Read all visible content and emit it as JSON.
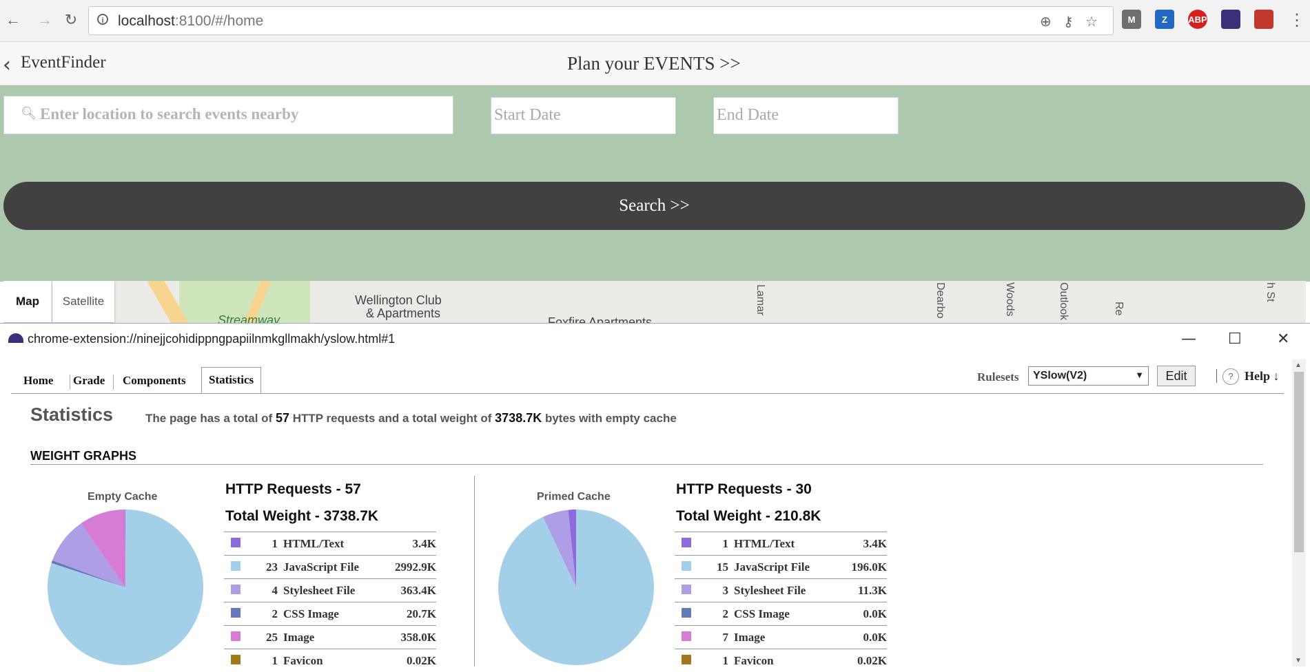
{
  "browser": {
    "url_host": "localhost",
    "url_rest": ":8100/#/home",
    "back_glyph": "←",
    "forward_glyph": "→",
    "reload_glyph": "↻",
    "extensions": [
      {
        "name": "m-extension",
        "label": "M",
        "color": "#6f6f6f"
      },
      {
        "name": "zotero-extension",
        "label": "Z",
        "color": "#2368c2"
      },
      {
        "name": "adblock-extension",
        "label": "ABP",
        "color": "#d61f1f"
      },
      {
        "name": "yslow-extension",
        "label": "",
        "color": "#3b2f79"
      },
      {
        "name": "red-extension",
        "label": "",
        "color": "#c0392b"
      }
    ]
  },
  "app": {
    "title": "EventFinder",
    "plan_link": "Plan your EVENTS >>",
    "search": {
      "location_placeholder": "Enter location to search events nearby",
      "start_placeholder": "Start Date",
      "end_placeholder": "End Date",
      "button_label": "Search >>"
    },
    "map": {
      "map_button": "Map",
      "satellite_button": "Satellite",
      "labels": [
        "Wellington Club",
        "& Apartments",
        "Foxfire Apartments",
        "Streamway"
      ],
      "vertical_labels": [
        "Lamar",
        "Dearbo",
        "Woods",
        "Outlook",
        "Re",
        "h St"
      ]
    }
  },
  "yslow": {
    "window_title": "chrome-extension://ninejjcohidippngpapiilnmkgllmakh/yslow.html#1",
    "tabs": [
      "Home",
      "Grade",
      "Components",
      "Statistics"
    ],
    "active_tab": "Statistics",
    "rulesets_label": "Rulesets",
    "ruleset_value": "YSlow(V2)",
    "edit_label": "Edit",
    "help_label": "Help ↓",
    "heading": "Statistics",
    "summary": {
      "prefix": "The page has a total of",
      "requests": "57",
      "middle": "HTTP requests and a total weight of",
      "weight": "3738.7K",
      "suffix": "bytes with empty cache"
    },
    "weight_graphs_heading": "WEIGHT GRAPHS",
    "colors": {
      "html": "#8e6ae0",
      "js": "#a3d0e8",
      "css": "#ae9ee6",
      "cssimg": "#6479b7",
      "image": "#d67bd6",
      "favicon": "#a2761a"
    },
    "empty_cache": {
      "title": "Empty Cache",
      "requests_line": "HTTP Requests - 57",
      "weight_line": "Total Weight - 3738.7K",
      "rows": [
        {
          "type": "html",
          "count": "1",
          "label": "HTML/Text",
          "size": "3.4K"
        },
        {
          "type": "js",
          "count": "23",
          "label": "JavaScript File",
          "size": "2992.9K"
        },
        {
          "type": "css",
          "count": "4",
          "label": "Stylesheet File",
          "size": "363.4K"
        },
        {
          "type": "cssimg",
          "count": "2",
          "label": "CSS Image",
          "size": "20.7K"
        },
        {
          "type": "image",
          "count": "25",
          "label": "Image",
          "size": "358.0K"
        },
        {
          "type": "favicon",
          "count": "1",
          "label": "Favicon",
          "size": "0.02K"
        }
      ]
    },
    "primed_cache": {
      "title": "Primed Cache",
      "requests_line": "HTTP Requests - 30",
      "weight_line": "Total Weight - 210.8K",
      "rows": [
        {
          "type": "html",
          "count": "1",
          "label": "HTML/Text",
          "size": "3.4K"
        },
        {
          "type": "js",
          "count": "15",
          "label": "JavaScript File",
          "size": "196.0K"
        },
        {
          "type": "css",
          "count": "3",
          "label": "Stylesheet File",
          "size": "11.3K"
        },
        {
          "type": "cssimg",
          "count": "2",
          "label": "CSS Image",
          "size": "0.0K"
        },
        {
          "type": "image",
          "count": "7",
          "label": "Image",
          "size": "0.0K"
        },
        {
          "type": "favicon",
          "count": "1",
          "label": "Favicon",
          "size": "0.02K"
        }
      ]
    }
  }
}
